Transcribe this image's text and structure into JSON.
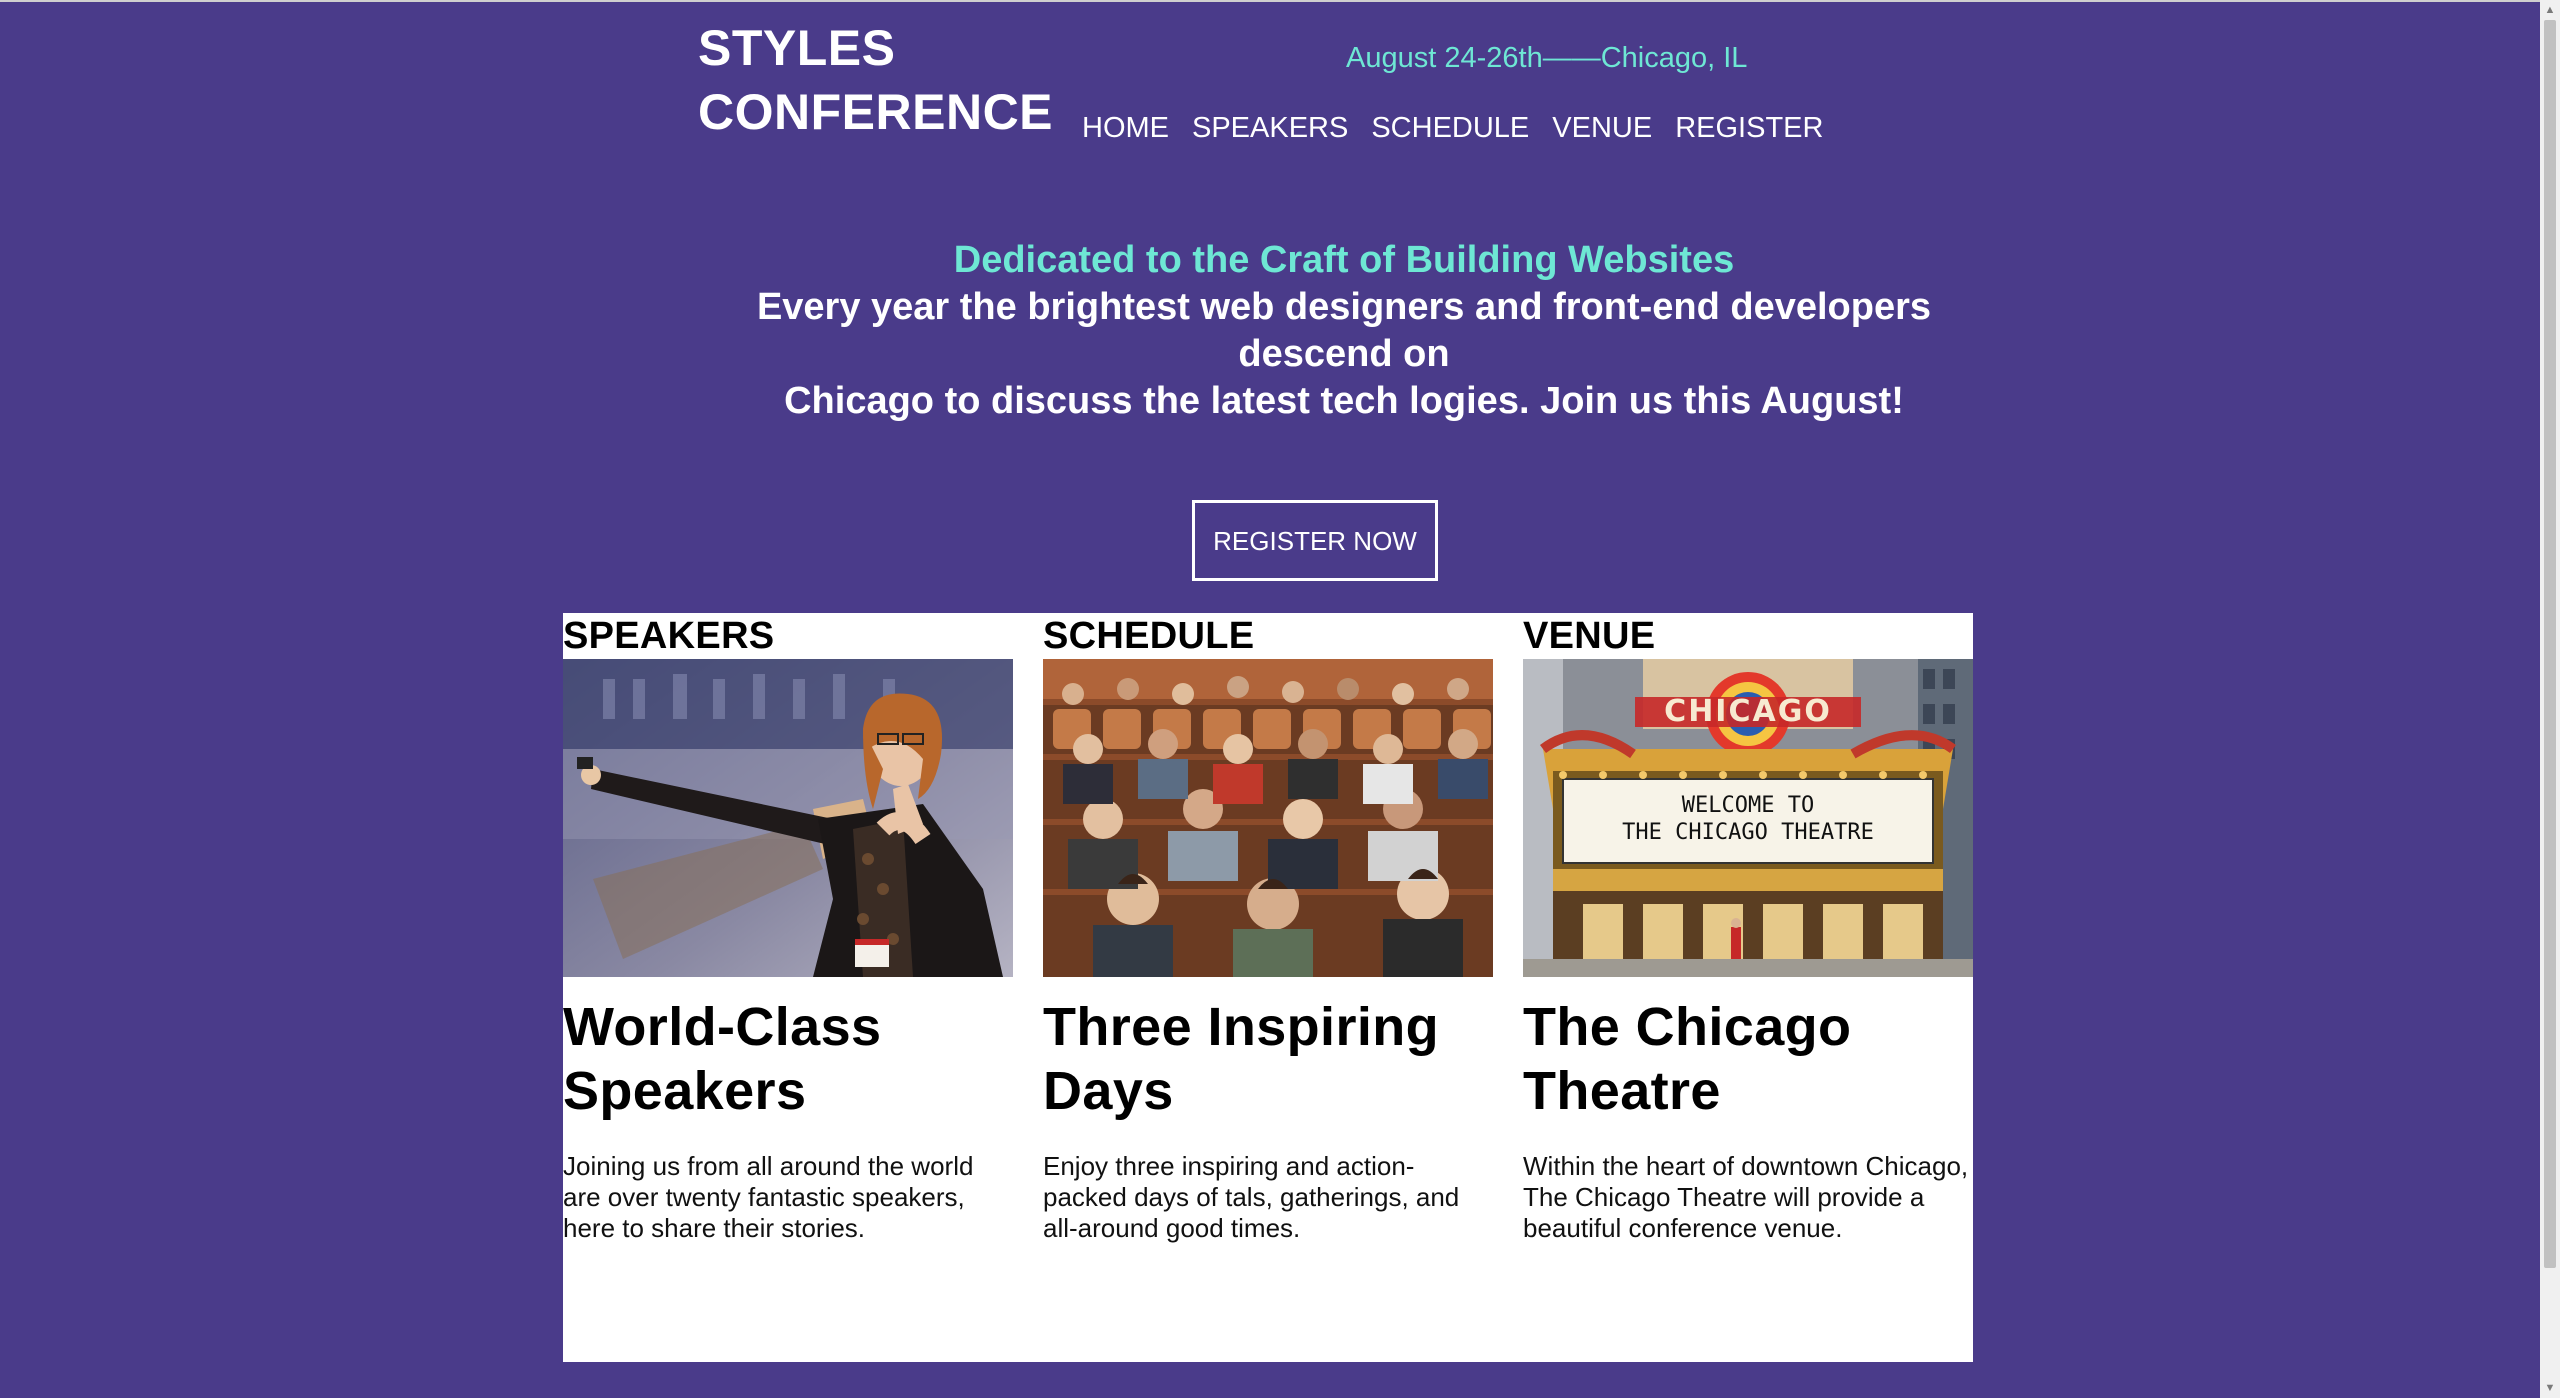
{
  "site": {
    "logo_line1": "STYLES",
    "logo_line2": "CONFERENCE",
    "dateline": "August 24-26th——Chicago, IL"
  },
  "nav": {
    "items": [
      {
        "label": "HOME"
      },
      {
        "label": "SPEAKERS"
      },
      {
        "label": "SCHEDULE"
      },
      {
        "label": "VENUE"
      },
      {
        "label": "REGISTER"
      }
    ]
  },
  "hero": {
    "tagline": "Dedicated to the Craft of Building Websites",
    "lead_line1": "Every year the brightest web designers and front-end developers",
    "lead_line2": "descend on",
    "lead_line3": "Chicago to discuss the latest tech logies. Join us this August!",
    "cta_label": "REGISTER NOW"
  },
  "sections": [
    {
      "heading": "SPEAKERS",
      "title": "World-Class Speakers",
      "body": "Joining us from all around the world are over twenty fantastic speakers, here to share their stories."
    },
    {
      "heading": "SCHEDULE",
      "title": "Three Inspiring Days",
      "body": "Enjoy three inspiring and action-packed days of tals, gatherings, and all-around good times."
    },
    {
      "heading": "VENUE",
      "title": "The Chicago Theatre",
      "body": "Within the heart of downtown Chicago, The Chicago Theatre will provide a beautiful conference venue."
    }
  ],
  "venue_photo_signs": {
    "marquee_top": "CHICAGO",
    "marquee_line1": "WELCOME  TO",
    "marquee_line2": "THE CHICAGO  THEATRE"
  },
  "colors": {
    "background": "#4a3b8a",
    "accent": "#6ee7d4",
    "panel": "#ffffff",
    "text_light": "#ffffff",
    "text_dark": "#000000"
  },
  "icons": [
    "scroll-up-arrow-icon",
    "scroll-down-arrow-icon"
  ]
}
